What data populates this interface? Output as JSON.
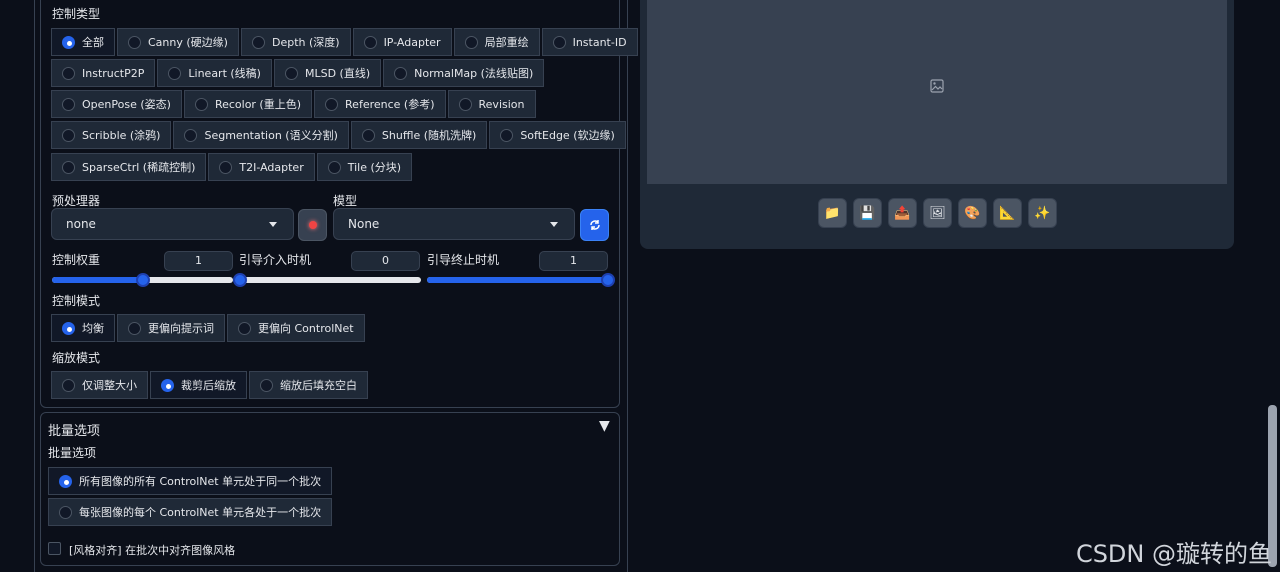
{
  "control_type": {
    "label": "控制类型",
    "rows": [
      [
        "全部",
        "Canny (硬边缘)",
        "Depth (深度)",
        "IP-Adapter",
        "局部重绘",
        "Instant-ID"
      ],
      [
        "InstructP2P",
        "Lineart (线稿)",
        "MLSD (直线)",
        "NormalMap (法线贴图)"
      ],
      [
        "OpenPose (姿态)",
        "Recolor (重上色)",
        "Reference (参考)",
        "Revision"
      ],
      [
        "Scribble (涂鸦)",
        "Segmentation (语义分割)",
        "Shuffle (随机洗牌)",
        "SoftEdge (软边缘)"
      ],
      [
        "SparseCtrl (稀疏控制)",
        "T2I-Adapter",
        "Tile (分块)"
      ]
    ],
    "selected": "全部"
  },
  "preprocessor": {
    "label": "预处理器",
    "value": "none"
  },
  "model": {
    "label": "模型",
    "value": "None"
  },
  "sliders": {
    "weight": {
      "label": "控制权重",
      "value": "1",
      "fraction": 0.5
    },
    "start": {
      "label": "引导介入时机",
      "value": "0",
      "fraction": 0.0
    },
    "end": {
      "label": "引导终止时机",
      "value": "1",
      "fraction": 1.0
    }
  },
  "control_mode": {
    "label": "控制模式",
    "options": [
      "均衡",
      "更偏向提示词",
      "更偏向 ControlNet"
    ],
    "selected": "均衡"
  },
  "resize_mode": {
    "label": "缩放模式",
    "options": [
      "仅调整大小",
      "裁剪后缩放",
      "缩放后填充空白"
    ],
    "selected": "裁剪后缩放"
  },
  "batch": {
    "title": "批量选项",
    "collapse_glyph": "▼",
    "sub_label": "批量选项",
    "options": [
      "所有图像的所有 ControlNet 单元处于同一个批次",
      "每张图像的每个 ControlNet 单元各处于一个批次"
    ],
    "selected": "所有图像的所有 ControlNet 单元处于同一个批次",
    "checkbox_label": "[风格对齐] 在批次中对齐图像风格"
  },
  "toolbar_icons": [
    "folder-icon",
    "save-icon",
    "transfer-icon",
    "image-icon",
    "palette-icon",
    "ruler-icon",
    "sparkle-icon"
  ],
  "toolbar_glyphs": [
    "📁",
    "💾",
    "📤",
    "🖼",
    "🎨",
    "📐",
    "✨"
  ],
  "watermark": "CSDN @璇转的鱼",
  "colors": {
    "accent": "#2563eb",
    "panel": "#1f2937",
    "background": "#0b0f19"
  }
}
